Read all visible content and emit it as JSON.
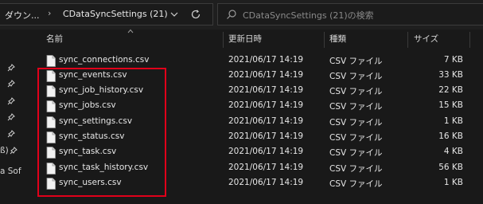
{
  "address_bar": {
    "crumb_parent": "ダウン...",
    "crumb_separator": "›",
    "crumb_current": "CDataSyncSettings (21)",
    "dropdown_icon": "chevron-down-icon",
    "refresh_icon": "refresh-icon"
  },
  "search": {
    "placeholder": "CDataSyncSettings (21)の検索",
    "icon": "search-icon"
  },
  "nav": {
    "pin_icon": "pin-icon",
    "partial_label_1": "ß)",
    "partial_label_2": "a Sof"
  },
  "columns": {
    "name": "名前",
    "date": "更新日時",
    "type": "種類",
    "size": "サイズ"
  },
  "files": [
    {
      "name": "sync_connections.csv",
      "date": "2021/06/17 14:19",
      "type": "CSV ファイル",
      "size": "7 KB"
    },
    {
      "name": "sync_events.csv",
      "date": "2021/06/17 14:19",
      "type": "CSV ファイル",
      "size": "33 KB"
    },
    {
      "name": "sync_job_history.csv",
      "date": "2021/06/17 14:19",
      "type": "CSV ファイル",
      "size": "22 KB"
    },
    {
      "name": "sync_jobs.csv",
      "date": "2021/06/17 14:19",
      "type": "CSV ファイル",
      "size": "15 KB"
    },
    {
      "name": "sync_settings.csv",
      "date": "2021/06/17 14:19",
      "type": "CSV ファイル",
      "size": "1 KB"
    },
    {
      "name": "sync_status.csv",
      "date": "2021/06/17 14:19",
      "type": "CSV ファイル",
      "size": "16 KB"
    },
    {
      "name": "sync_task.csv",
      "date": "2021/06/17 14:19",
      "type": "CSV ファイル",
      "size": "4 KB"
    },
    {
      "name": "sync_task_history.csv",
      "date": "2021/06/17 14:19",
      "type": "CSV ファイル",
      "size": "56 KB"
    },
    {
      "name": "sync_users.csv",
      "date": "2021/06/17 14:19",
      "type": "CSV ファイル",
      "size": "1 KB"
    }
  ],
  "colors": {
    "background": "#191919",
    "highlight_border": "#e0001a",
    "text": "#e6e6e6"
  }
}
